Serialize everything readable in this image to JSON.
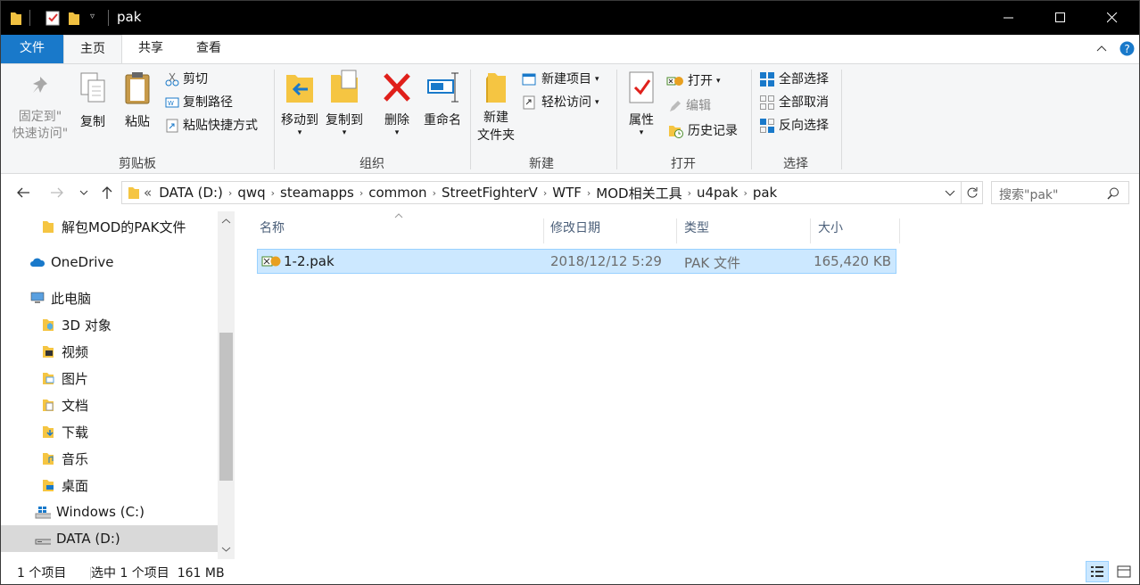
{
  "window": {
    "title": "pak"
  },
  "tabs": {
    "file": "文件",
    "home": "主页",
    "share": "共享",
    "view": "查看"
  },
  "ribbon": {
    "clipboard": {
      "pin_line1": "固定到\"",
      "pin_line2": "快速访问\"",
      "copy": "复制",
      "paste": "粘贴",
      "cut": "剪切",
      "copy_path": "复制路径",
      "paste_shortcut": "粘贴快捷方式",
      "label": "剪贴板"
    },
    "organize": {
      "move_to": "移动到",
      "copy_to": "复制到",
      "delete": "删除",
      "rename": "重命名",
      "label": "组织"
    },
    "new": {
      "new_folder_line1": "新建",
      "new_folder_line2": "文件夹",
      "new_item": "新建项目",
      "easy_access": "轻松访问",
      "label": "新建"
    },
    "open": {
      "properties": "属性",
      "open": "打开",
      "edit": "编辑",
      "history": "历史记录",
      "label": "打开"
    },
    "select": {
      "select_all": "全部选择",
      "select_none": "全部取消",
      "invert": "反向选择",
      "label": "选择"
    }
  },
  "address": {
    "overflow": "«",
    "crumbs": [
      "DATA (D:)",
      "qwq",
      "steamapps",
      "common",
      "StreetFighterV",
      "WTF",
      "MOD相关工具",
      "u4pak",
      "pak"
    ],
    "search_placeholder": "搜索\"pak\""
  },
  "nav": {
    "items": [
      {
        "label": "解包MOD的PAK文件",
        "icon": "folder-icon"
      },
      {
        "label": "OneDrive",
        "icon": "cloud-icon"
      },
      {
        "label": "此电脑",
        "icon": "computer-icon"
      },
      {
        "label": "3D 对象",
        "icon": "3d-objects-icon"
      },
      {
        "label": "视频",
        "icon": "video-folder-icon"
      },
      {
        "label": "图片",
        "icon": "pictures-folder-icon"
      },
      {
        "label": "文档",
        "icon": "documents-folder-icon"
      },
      {
        "label": "下载",
        "icon": "downloads-folder-icon"
      },
      {
        "label": "音乐",
        "icon": "music-folder-icon"
      },
      {
        "label": "桌面",
        "icon": "desktop-folder-icon"
      },
      {
        "label": "Windows (C:)",
        "icon": "windows-drive-icon"
      },
      {
        "label": "DATA (D:)",
        "icon": "drive-icon"
      }
    ]
  },
  "columns": {
    "name": "名称",
    "modified": "修改日期",
    "type": "类型",
    "size": "大小"
  },
  "files": [
    {
      "name": "1-2.pak",
      "modified": "2018/12/12 5:29",
      "type": "PAK 文件",
      "size": "165,420 KB"
    }
  ],
  "status": {
    "count": "1 个项目",
    "selected": "选中 1 个项目  161 MB"
  },
  "colors": {
    "accent": "#1979ca",
    "selection": "#cce8ff",
    "folder": "#f0c040"
  }
}
